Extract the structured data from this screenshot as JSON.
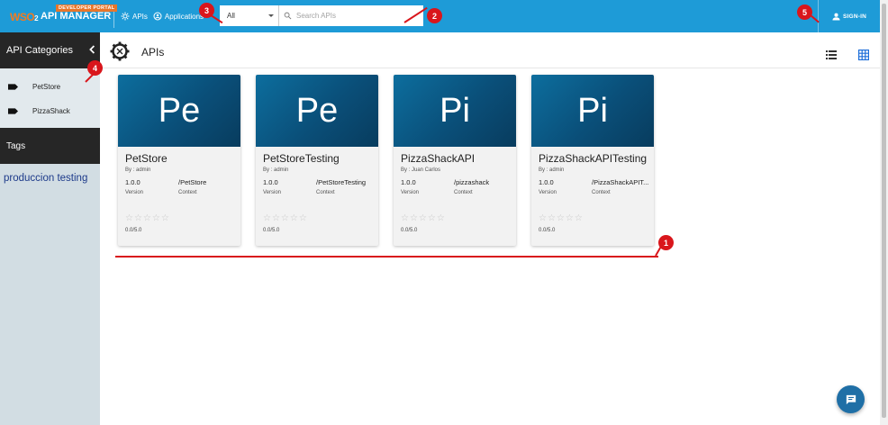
{
  "header": {
    "logo_badge": "DEVELOPER PORTAL",
    "logo_wso": "WSO",
    "logo_two": "2",
    "logo_product": "API MANAGER",
    "nav": [
      {
        "label": "APIs",
        "icon": "gear-icon"
      },
      {
        "label": "Applications",
        "icon": "apps-icon"
      }
    ],
    "search": {
      "scope_value": "All",
      "placeholder": "Search APIs"
    },
    "signin_label": "SIGN-IN"
  },
  "sidebar": {
    "categories_title": "API Categories",
    "categories": [
      {
        "label": "PetStore"
      },
      {
        "label": "PizzaShack"
      }
    ],
    "tags_title": "Tags",
    "tag_cloud": "produccion testing"
  },
  "main": {
    "title": "APIs",
    "cards": [
      {
        "thumb": "Pe",
        "name": "PetStore",
        "by": "By : admin",
        "version": "1.0.0",
        "version_label": "Version",
        "context": "/PetStore",
        "context_label": "Context",
        "stars": "☆☆☆☆☆",
        "rating": "0.0/5.0"
      },
      {
        "thumb": "Pe",
        "name": "PetStoreTesting",
        "by": "By : admin",
        "version": "1.0.0",
        "version_label": "Version",
        "context": "/PetStoreTesting",
        "context_label": "Context",
        "stars": "☆☆☆☆☆",
        "rating": "0.0/5.0"
      },
      {
        "thumb": "Pi",
        "name": "PizzaShackAPI",
        "by": "By : Juan Carlos",
        "version": "1.0.0",
        "version_label": "Version",
        "context": "/pizzashack",
        "context_label": "Context",
        "stars": "☆☆☆☆☆",
        "rating": "0.0/5.0"
      },
      {
        "thumb": "Pi",
        "name": "PizzaShackAPITesting",
        "by": "By : admin",
        "version": "1.0.0",
        "version_label": "Version",
        "context": "/PizzaShackAPIT...",
        "context_label": "Context",
        "stars": "☆☆☆☆☆",
        "rating": "0.0/5.0"
      }
    ]
  },
  "annotations": [
    "1",
    "2",
    "3",
    "4",
    "5"
  ],
  "colors": {
    "header": "#1e9bd7",
    "sidebar": "#d2dde3",
    "dark_band": "#262626",
    "accent_red": "#d9161c",
    "thumb_blue": "#0a4f79",
    "chat_button": "#1f6fa6"
  }
}
